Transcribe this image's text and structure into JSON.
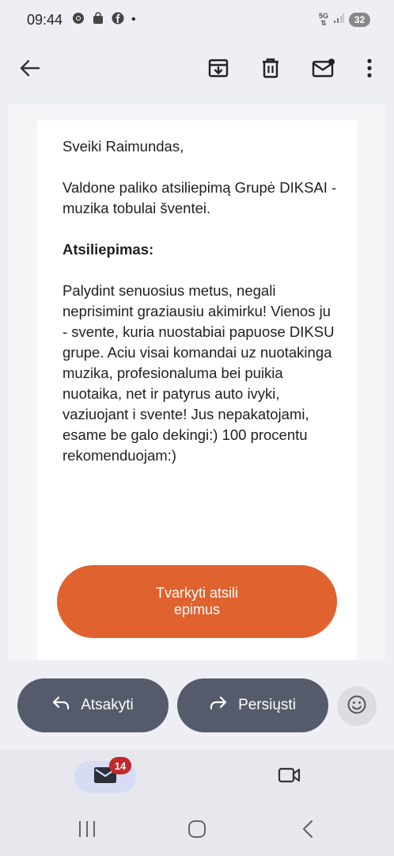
{
  "status_bar": {
    "time": "09:44",
    "network": "5G",
    "battery": "32",
    "dot": "•"
  },
  "toolbar": {
    "back_icon": "arrow-left-icon",
    "archive_icon": "archive-icon",
    "delete_icon": "trash-icon",
    "mark_unread_icon": "mail-unread-icon",
    "more_icon": "more-vertical-icon"
  },
  "message": {
    "greeting": "Sveiki Raimundas,",
    "intro": "Valdone paliko atsiliepimą Grupė DIKSAI - muzika tobulai šventei.",
    "review_heading": "Atsiliepimas:",
    "review_body": "Palydint senuosius metus, negali neprisimint graziausiu akimirku! Vienos ju - svente, kuria nuostabiai papuose DIKSU grupe. Aciu visai komandai uz nuotakinga muzika, profesionaluma bei puikia nuotaika, net ir patyrus auto ivyki, vaziuojant i svente! Jus nepakatojami, esame be galo dekingi:) 100 procentu rekomenduojam:)",
    "cta_label": "Tvarkyti atsiliepimus"
  },
  "reply_bar": {
    "reply_label": "Atsakyti",
    "forward_label": "Persiųsti"
  },
  "bottom_nav": {
    "mail_badge": "14"
  },
  "colors": {
    "accent": "#e0622f",
    "pill": "#555b6b",
    "badge": "#c2282e",
    "nav_active": "#d5dcf3"
  }
}
